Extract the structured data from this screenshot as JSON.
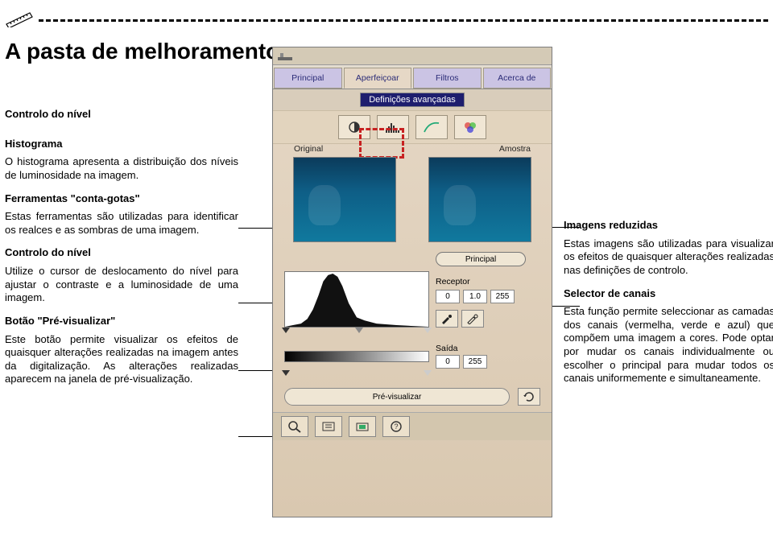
{
  "title_main": "A pasta de melhoramentos:",
  "title_sub": "Controlo do nível",
  "left": {
    "sec1_title": "Controlo do nível",
    "sec2_title": "Histograma",
    "sec2_body": "O histograma apresenta a distribuição dos níveis de luminosidade na imagem.",
    "sec3_title": "Ferramentas \"conta-gotas\"",
    "sec3_body": "Estas ferramentas são utilizadas para identificar os realces e as sombras de uma imagem.",
    "sec4_title": "Controlo do nível",
    "sec4_body": "Utilize o cursor de deslocamento do nível para ajustar o contraste e a luminosidade de uma imagem.",
    "sec5_title": "Botão \"Pré-visualizar\"",
    "sec5_body": "Este botão permite visualizar os efeitos de quaisquer alterações realizadas na imagem antes da digitalização. As alterações realizadas aparecem na janela de pré-visualização."
  },
  "right": {
    "sec1_title": "Imagens reduzidas",
    "sec1_body": "Estas imagens são utilizadas para visualizar os efeitos de quaisquer alterações realizadas nas definições de controlo.",
    "sec2_title": "Selector de canais",
    "sec2_body": "Esta função permite seleccionar as camadas dos canais (vermelha, verde e azul) que compõem uma imagem a cores. Pode optar por mudar os canais individualmente ou escolher o principal para mudar todos os canais uniformemente e simultaneamente."
  },
  "panel": {
    "tabs": [
      "Principal",
      "Aperfeiçoar",
      "Filtros",
      "Acerca de"
    ],
    "adv_button": "Definições avançadas",
    "label_original": "Original",
    "label_sample": "Amostra",
    "channel_label": "Principal",
    "receptor_label": "Receptor",
    "receptor_vals": [
      "0",
      "1.0",
      "255"
    ],
    "output_label": "Saída",
    "output_vals": [
      "0",
      "255"
    ],
    "preview_btn": "Pré-visualizar"
  }
}
